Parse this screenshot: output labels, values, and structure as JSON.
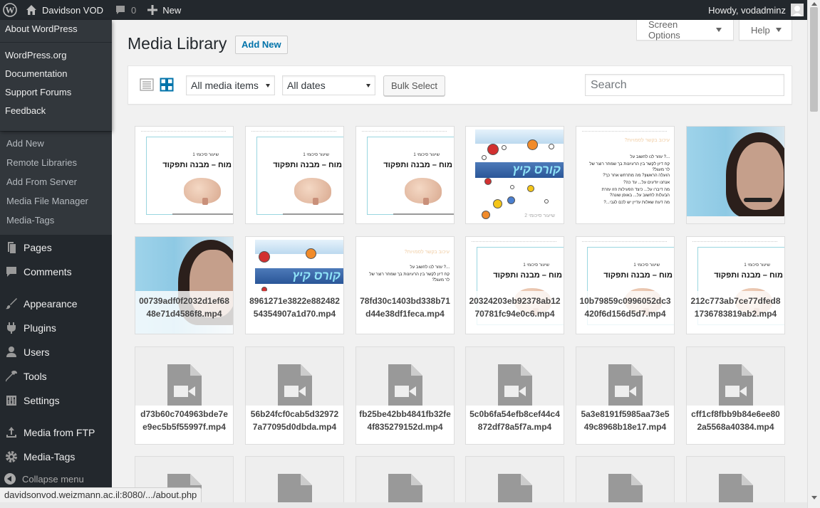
{
  "adminbar": {
    "site_name": "Davidson VOD",
    "comments_count": "0",
    "new_label": "New",
    "howdy": "Howdy, vodadminz"
  },
  "sidebar": {
    "about_items": [
      "About WordPress"
    ],
    "wp_links": [
      "WordPress.org",
      "Documentation",
      "Support Forums",
      "Feedback"
    ],
    "media_sub": [
      "Add New",
      "Remote Libraries",
      "Add From Server",
      "Media File Manager",
      "Media-Tags"
    ],
    "menu": [
      "Pages",
      "Comments",
      "Appearance",
      "Plugins",
      "Users",
      "Tools",
      "Settings",
      "Media from FTP",
      "Media-Tags"
    ],
    "collapse": "Collapse menu"
  },
  "header": {
    "screen_options": "Screen Options",
    "help": "Help",
    "title": "Media Library",
    "add_new": "Add New"
  },
  "toolbar": {
    "filter_type": "All media items",
    "filter_date": "All dates",
    "bulk_select": "Bulk Select",
    "search_placeholder": "Search"
  },
  "slide": {
    "subtitle": "שיעור סיכומי 1",
    "title": "מוח – מבנה ותפקוד",
    "course_title": "קורס קיץ",
    "course_footer": "שיעור סיכומי 2",
    "q_lines": [
      "עיכוב בקשר לסמויות?",
      "...? עזור לנו לחשוב על",
      "קח דיון לקשר בין הרעיונות בך שמחר רוצר של",
      "לר מעגל?",
      "הועלה הראשון? מה מתרחש אחר כך?",
      "אנחנו יודעים על... עד כה?",
      "מה דיברו על... כיצד הפעילות הזו עזרת",
      "הבעלות לחשוב על... באופן שונה?",
      "מה דעת שאלות עדיין יש לכם לגבי...?"
    ]
  },
  "captions": [
    "00739adf0f2032d1ef6848e71d4586f8.mp4",
    "8961271e3822e88248254354907a1d70.mp4",
    "78fd30c1403bd338b71d44e38df1feca.mp4",
    "20324203eb92378ab1270781fc94e0c6.mp4",
    "10b79859c0996052dc3420f6d156d5d7.mp4",
    "212c773ab7ce77dfed81736783819ab2.mp4",
    "d73b60c704963bde7ee9ec5b5f55997f.mp4",
    "56b24fcf0cab5d329727a77095d0dbda.mp4",
    "fb25be42bb4841fb32fe4f835279152d.mp4",
    "5c0b6fa54efb8cef44c4872df78a5f7a.mp4",
    "5a3e8191f5985aa73e549c8968b18e17.mp4",
    "cff1cf8fbb9b84e6ee802a5568a40384.mp4"
  ],
  "statusbar": "davidsonvod.weizmann.ac.il:8080/.../about.php",
  "colors": {
    "adminbar": "#23282d",
    "sidebar": "#23282d",
    "submenu": "#32373c",
    "link": "#0073aa",
    "active_view": "#0073aa"
  }
}
